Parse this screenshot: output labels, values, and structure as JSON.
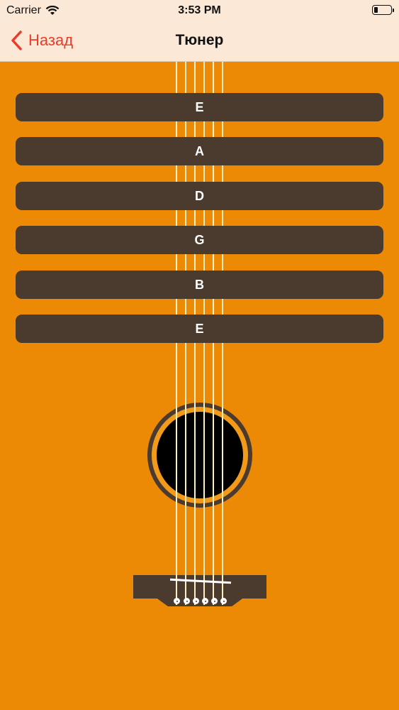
{
  "status_bar": {
    "carrier": "Carrier",
    "time": "3:53 PM",
    "battery_level": 0.25
  },
  "nav": {
    "back_label": "Назад",
    "title": "Тюнер"
  },
  "tuning_buttons": [
    {
      "label": "E"
    },
    {
      "label": "A"
    },
    {
      "label": "D"
    },
    {
      "label": "G"
    },
    {
      "label": "B"
    },
    {
      "label": "E"
    }
  ],
  "colors": {
    "body": "#EC8A06",
    "wood_dark": "#4B3A2E",
    "string": "#FFF0C2",
    "nav_bg": "#FBE8D6",
    "accent": "#EE3A2A"
  }
}
